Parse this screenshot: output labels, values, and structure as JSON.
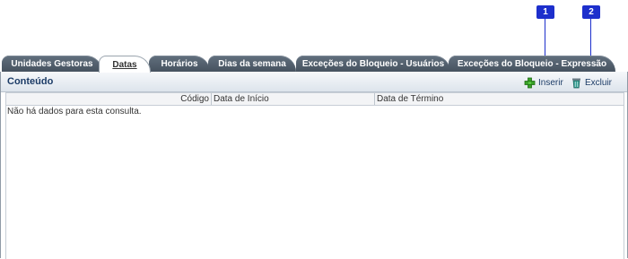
{
  "markers": [
    "1",
    "2"
  ],
  "tabs": [
    {
      "label": "Unidades Gestoras",
      "active": false
    },
    {
      "label": "Datas",
      "active": true
    },
    {
      "label": "Horários",
      "active": false
    },
    {
      "label": "Dias da semana",
      "active": false
    },
    {
      "label": "Exceções do Bloqueio - Usuários",
      "active": false
    },
    {
      "label": "Exceções do Bloqueio - Expressão",
      "active": false
    }
  ],
  "panel": {
    "title": "Conteúdo",
    "actions": {
      "insert_label": "Inserir",
      "insert_icon": "add-icon",
      "delete_label": "Excluir",
      "delete_icon": "trash-icon"
    }
  },
  "grid": {
    "columns": [
      "Código",
      "Data de Início",
      "Data de Término"
    ],
    "empty_message": "Não há dados para esta consulta."
  },
  "colors": {
    "tab_inactive": "#4f5b67",
    "marker": "#1d2fcc",
    "title": "#1b3b66",
    "add_icon": "#3aa12a"
  }
}
